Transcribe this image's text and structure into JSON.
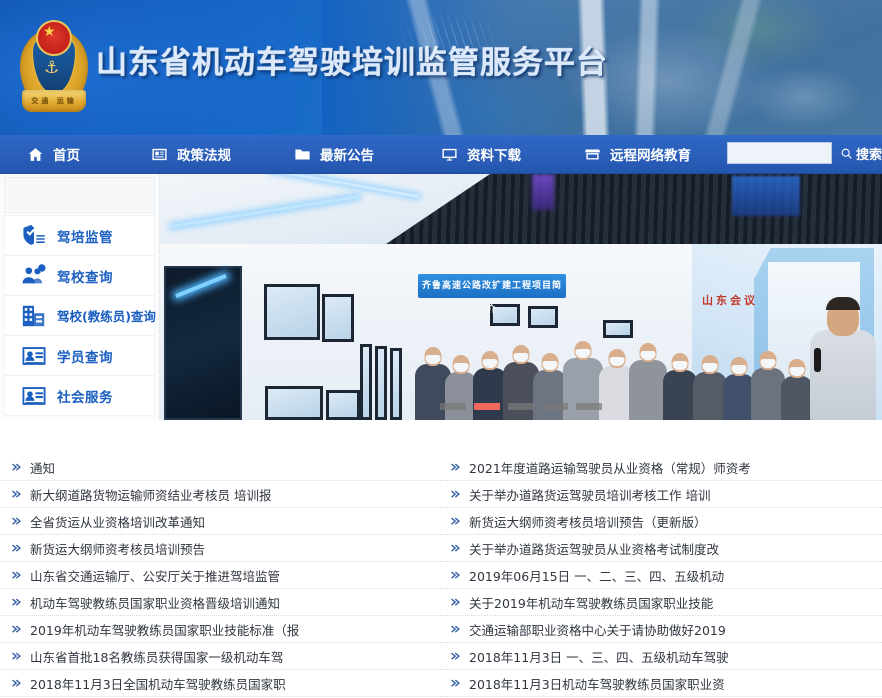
{
  "header": {
    "site_title": "山东省机动车驾驶培训监管服务平台",
    "emblem_name": "national-emblem-logo",
    "emblem_ribbon_text": "交通 运输"
  },
  "nav": {
    "items": [
      {
        "label": "首页",
        "icon": "home-icon"
      },
      {
        "label": "政策法规",
        "icon": "document-icon"
      },
      {
        "label": "最新公告",
        "icon": "folder-icon"
      },
      {
        "label": "资料下载",
        "icon": "monitor-icon"
      },
      {
        "label": "远程网络教育",
        "icon": "shop-icon"
      }
    ],
    "search": {
      "value": "",
      "placeholder": "",
      "button_label": "搜索",
      "icon": "search-icon"
    }
  },
  "sidebar": {
    "items": [
      {
        "label": "驾培监管",
        "icon": "shield-icon"
      },
      {
        "label": "驾校查询",
        "icon": "people-search-icon"
      },
      {
        "label": "驾校(教练员)查询",
        "icon": "building-icon"
      },
      {
        "label": "学员查询",
        "icon": "id-card-icon"
      },
      {
        "label": "社会服务",
        "icon": "id-card-icon"
      }
    ]
  },
  "banner": {
    "alt": "展厅参观照片",
    "caption_blue": "齐鲁高速公路改扩建工程项目简介",
    "caption_red": "山东会议",
    "slides_count": 5,
    "active_slide": 2
  },
  "news": {
    "left_column": [
      "通知",
      "新大纲道路货物运输师资结业考核员 培训报",
      "全省货运从业资格培训改革通知",
      "新货运大纲师资考核员培训预告",
      "山东省交通运输厅、公安厅关于推进驾培监管",
      "机动车驾驶教练员国家职业资格晋级培训通知",
      "2019年机动车驾驶教练员国家职业技能标准（报",
      "山东省首批18名教练员获得国家一级机动车驾",
      "2018年11月3日全国机动车驾驶教练员国家职"
    ],
    "right_column": [
      "2021年度道路运输驾驶员从业资格（常规）师资考",
      "关于举办道路货运驾驶员培训考核工作 培训",
      "新货运大纲师资考核员培训预告（更新版）",
      "关于举办道路货运驾驶员从业资格考试制度改",
      "2019年06月15日 一、二、三、四、五级机动",
      "关于2019年机动车驾驶教练员国家职业技能",
      "交通运输部职业资格中心关于请协助做好2019",
      "2018年11月3日 一、三、四、五级机动车驾驶",
      "2018年11月3日机动车驾驶教练员国家职业资"
    ]
  },
  "colors": {
    "header_blue": "#1362c2",
    "nav_blue": "#2a5fbb",
    "accent_blue": "#1b5fc0",
    "active_dot_red": "#f2685e",
    "inactive_dot_gray": "#787878",
    "news_text": "#303640"
  }
}
